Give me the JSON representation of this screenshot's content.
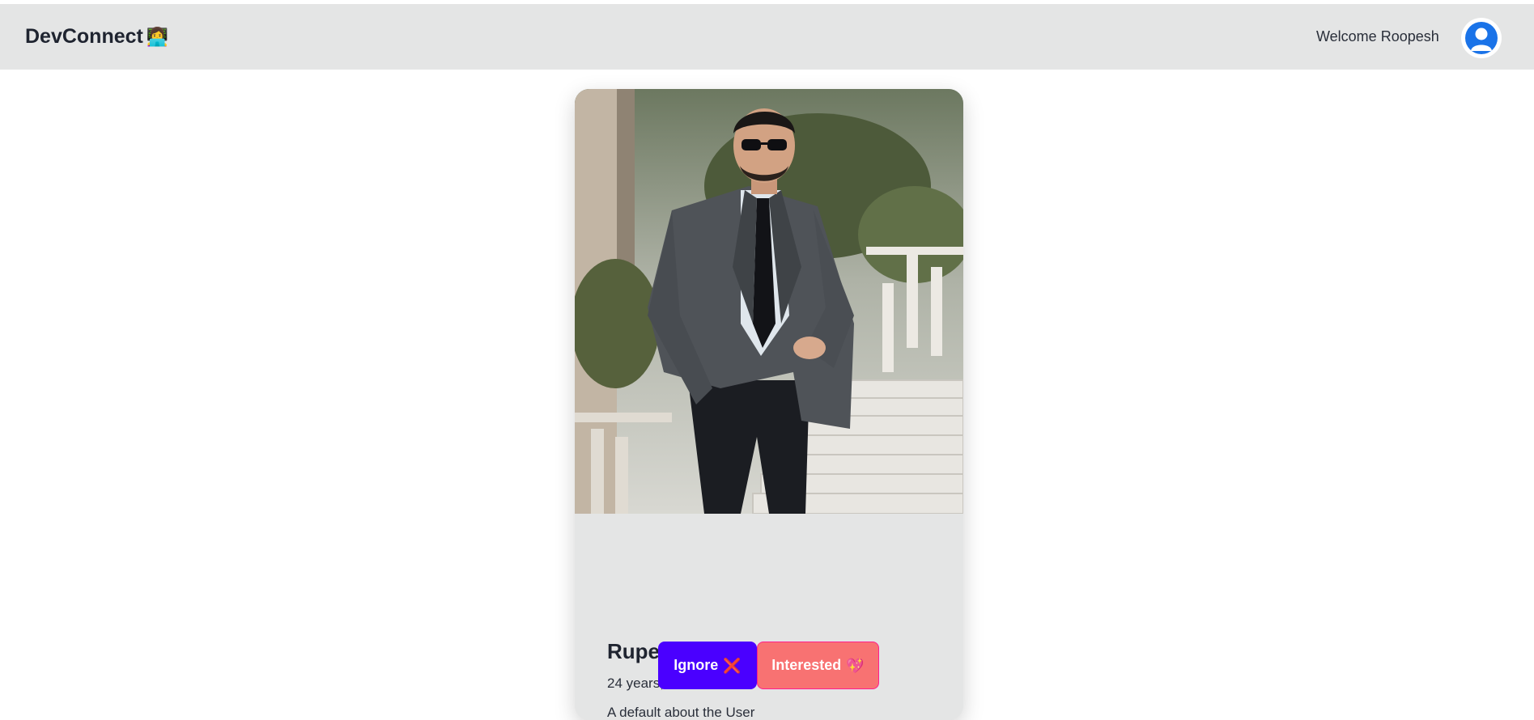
{
  "app": {
    "brand": "DevConnect",
    "brand_icon": "👩‍💻"
  },
  "header": {
    "welcome_text": "Welcome Roopesh",
    "avatar_icon": "user-avatar-icon"
  },
  "feed_card": {
    "photo_alt": "profile-photo",
    "name": "Rupesh Nagineni",
    "age_gender": "24 years,male",
    "about": "A default about the User",
    "buttons": {
      "ignore_label": "Ignore",
      "ignore_icon": "❌",
      "interested_label": "Interested",
      "interested_icon": "💖"
    }
  },
  "colors": {
    "navbar_bg": "#e4e5e5",
    "card_bg": "#e4e5e5",
    "ignore_bg": "#4a00ff",
    "interested_bg": "#f87272",
    "interested_border": "#ff1f8f",
    "avatar_blue": "#1a73e8"
  }
}
